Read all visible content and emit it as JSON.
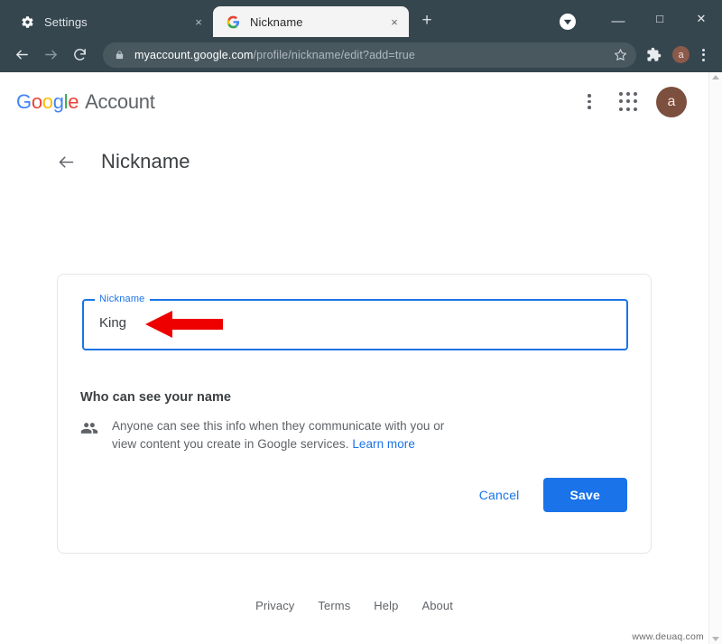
{
  "browser": {
    "tabs": [
      {
        "title": "Settings",
        "favicon": "gear-icon",
        "active": false,
        "close_label": "×"
      },
      {
        "title": "Nickname",
        "favicon": "google-g-icon",
        "active": true,
        "close_label": "×"
      }
    ],
    "new_tab_label": "+",
    "window_controls": {
      "minimize": "—",
      "maximize": "□",
      "close": "✕"
    },
    "download_badge_icon": "download-indicator-icon",
    "nav": {
      "back_icon": "back-arrow-icon",
      "forward_icon": "forward-arrow-icon",
      "reload_icon": "reload-icon"
    },
    "omnibox": {
      "lock_icon": "lock-icon",
      "url_host": "myaccount.google.com",
      "url_path": "/profile/nickname/edit?add=true",
      "star_icon": "bookmark-star-icon"
    },
    "toolbar": {
      "extensions_icon": "puzzle-piece-icon",
      "profile_initial": "a",
      "menu_icon": "three-dot-menu-icon"
    }
  },
  "page": {
    "header": {
      "logo_letters": [
        "G",
        "o",
        "o",
        "g",
        "l",
        "e"
      ],
      "product": "Account",
      "menu_icon": "three-dot-menu-icon",
      "apps_icon": "apps-grid-icon",
      "avatar_initial": "a"
    },
    "title_row": {
      "back_icon": "back-arrow-icon",
      "title": "Nickname"
    },
    "card": {
      "field": {
        "label": "Nickname",
        "value": "King"
      },
      "annotation": {
        "icon": "red-arrow-left",
        "color": "#ee0000"
      },
      "section_title": "Who can see your name",
      "info_icon": "people-icon",
      "info_text": "Anyone can see this info when they communicate with you or view content you create in Google services. ",
      "info_link": "Learn more",
      "cancel_label": "Cancel",
      "save_label": "Save"
    },
    "footer_links": [
      "Privacy",
      "Terms",
      "Help",
      "About"
    ],
    "watermark": "www.deuaq.com"
  },
  "colors": {
    "accent_blue": "#1a73e8",
    "chrome_bg": "#35464f",
    "omnibox_bg": "#49585f",
    "annotation_red": "#ee0000"
  }
}
